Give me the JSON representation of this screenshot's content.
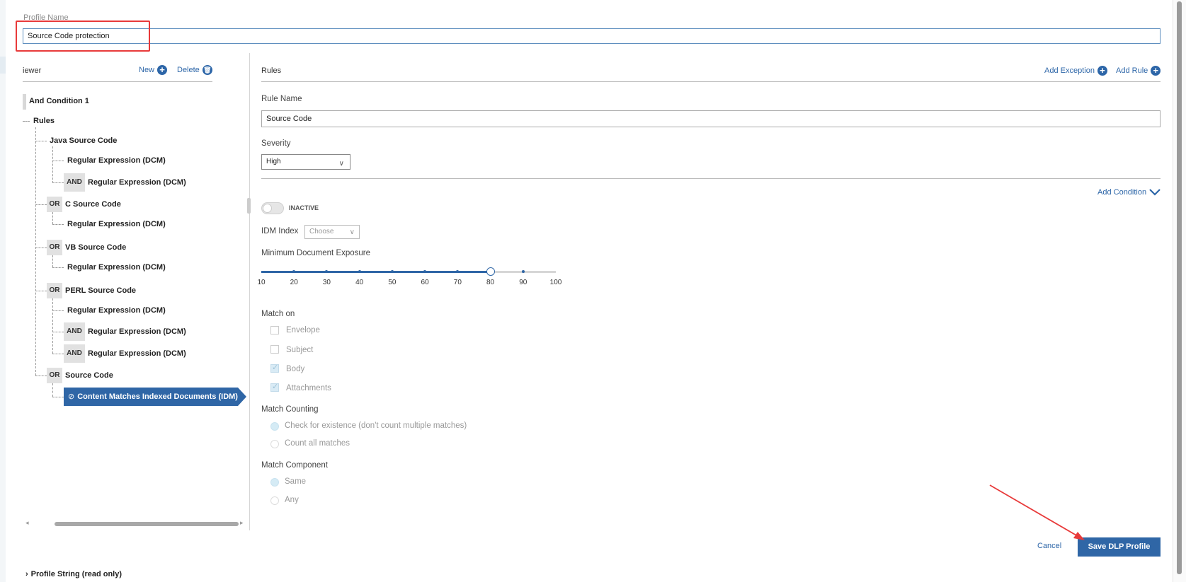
{
  "profile": {
    "label": "Profile Name",
    "value": "Source Code protection"
  },
  "viewer": {
    "title": "iewer",
    "new_label": "New",
    "delete_label": "Delete",
    "tree": {
      "and_condition": "And Condition 1",
      "rules_label": "Rules",
      "java": "Java Source Code",
      "java_r1": "Regular Expression (DCM)",
      "java_r2": "Regular Expression (DCM)",
      "c": "C Source Code",
      "c_r1": "Regular Expression (DCM)",
      "vb": "VB Source Code",
      "vb_r1": "Regular Expression (DCM)",
      "perl": "PERL Source Code",
      "perl_r1": "Regular Expression (DCM)",
      "perl_r2": "Regular Expression (DCM)",
      "perl_r3": "Regular Expression (DCM)",
      "source": "Source Code",
      "idm": "Content Matches Indexed Documents (IDM)",
      "op_and": "AND",
      "op_or": "OR"
    }
  },
  "rules_panel": {
    "title": "Rules",
    "add_exception": "Add Exception",
    "add_rule": "Add Rule",
    "rule_name_label": "Rule Name",
    "rule_name_value": "Source Code",
    "severity_label": "Severity",
    "severity_value": "High",
    "add_condition": "Add Condition",
    "toggle_label": "INACTIVE",
    "toggle_on": false,
    "idm_index_label": "IDM Index",
    "idm_index_placeholder": "Choose",
    "min_exposure_label": "Minimum Document Exposure",
    "slider": {
      "ticks": [
        "10",
        "20",
        "30",
        "40",
        "50",
        "60",
        "70",
        "80",
        "90",
        "100"
      ],
      "value": 80
    },
    "match_on_label": "Match on",
    "match_on": [
      {
        "label": "Envelope",
        "checked": false
      },
      {
        "label": "Subject",
        "checked": false
      },
      {
        "label": "Body",
        "checked": true
      },
      {
        "label": "Attachments",
        "checked": true
      }
    ],
    "match_counting_label": "Match Counting",
    "match_counting": [
      {
        "label": "Check for existence (don't count multiple matches)",
        "checked": true
      },
      {
        "label": "Count all matches",
        "checked": false
      }
    ],
    "match_component_label": "Match Component",
    "match_component": [
      {
        "label": "Same",
        "checked": true
      },
      {
        "label": "Any",
        "checked": false
      }
    ]
  },
  "footer": {
    "cancel": "Cancel",
    "save": "Save DLP Profile",
    "profile_string": "Profile String (read only)"
  },
  "colors": {
    "accent": "#2f66a6",
    "annotation_red": "#e83a3a"
  }
}
